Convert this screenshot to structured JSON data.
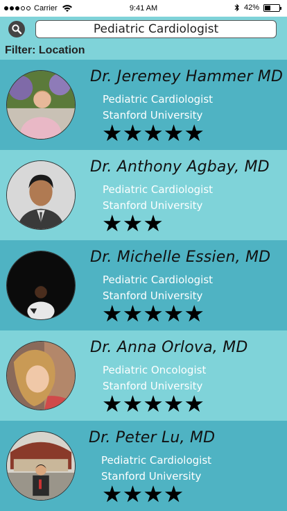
{
  "status_bar": {
    "carrier": "Carrier",
    "time": "9:41 AM",
    "battery_percent_label": "42%",
    "battery_level": 0.42,
    "signal_bars": 3,
    "signal_total": 5
  },
  "search": {
    "query": "Pediatric Cardiologist",
    "icon": "search-icon"
  },
  "filter": {
    "label": "Filter: Location"
  },
  "colors": {
    "row_dark": "#4fb3c3",
    "row_light": "#7fd3d9",
    "text_white": "#ffffff",
    "star": "#000000"
  },
  "doctors": [
    {
      "name": "Dr. Jeremey Hammer MD",
      "specialty": "Pediatric Cardiologist",
      "university": "Stanford University",
      "rating": 5
    },
    {
      "name": "Dr. Anthony Agbay, MD",
      "specialty": "Pediatric Cardiologist",
      "university": "Stanford University",
      "rating": 3
    },
    {
      "name": "Dr. Michelle Essien, MD",
      "specialty": "Pediatric Cardiologist",
      "university": "Stanford University",
      "rating": 5
    },
    {
      "name": "Dr. Anna Orlova, MD",
      "specialty": "Pediatric Oncologist",
      "university": "Stanford University",
      "rating": 5
    },
    {
      "name": "Dr. Peter Lu, MD",
      "specialty": "Pediatric Cardiologist",
      "university": "Stanford University",
      "rating": 4
    }
  ]
}
